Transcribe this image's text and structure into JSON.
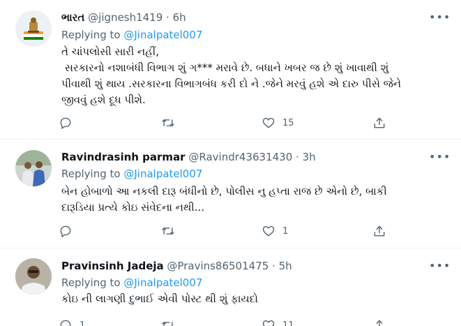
{
  "tweets": [
    {
      "name": "ભારત",
      "handle": "@jignesh1419",
      "time": "6h",
      "replying_label": "Replying to",
      "replying_to": "@Jinalpatel007",
      "text": "તે ચાંપલોસી સારી નહીં,\n સરકારનો નશાબંધી વિભાગ શું ગ*** મરાવે છે. બધાને ખબર જ છે શું ખાવાથી શું\nપીવાથી શું થાય .સરકારના વિભાગબંધ કરી દો ને .જેને મરવું હશે એ દારુ પીસે જેને\nજીવવું હશે દૂધ પીશે.",
      "replies": "",
      "retweets": "",
      "likes": "15",
      "avatar_icon": "emblem-avatar"
    },
    {
      "name": "Ravindrasinh parmar",
      "handle": "@Ravindr43631430",
      "time": "3h",
      "replying_label": "Replying to",
      "replying_to": "@Jinalpatel007",
      "text": "બેન હોબાળો આ નકલી દારૂ બંધીનો છે, પોલીસ નુ હપ્તા રાજ છે એનો છે, બાકી\nદારૂડિયા પ્રત્યે કોઇ સંવેદના નથી...",
      "replies": "",
      "retweets": "",
      "likes": "1",
      "avatar_icon": "two-people-avatar"
    },
    {
      "name": "Pravinsinh Jadeja",
      "handle": "@Pravins86501475",
      "time": "5h",
      "replying_label": "Replying to",
      "replying_to": "@Jinalpatel007",
      "text": "કોઇ ની લાગણી દુભાઈ એવી પોસ્ટ થી શું ફાયદો",
      "replies": "1",
      "retweets": "",
      "likes": "11",
      "avatar_icon": "man-portrait-avatar"
    }
  ],
  "more_icon": "more-options-icon",
  "colors": {
    "link": "#1d9bf0",
    "secondary": "#536471",
    "text": "#0f1419",
    "divider": "#eff3f4"
  }
}
